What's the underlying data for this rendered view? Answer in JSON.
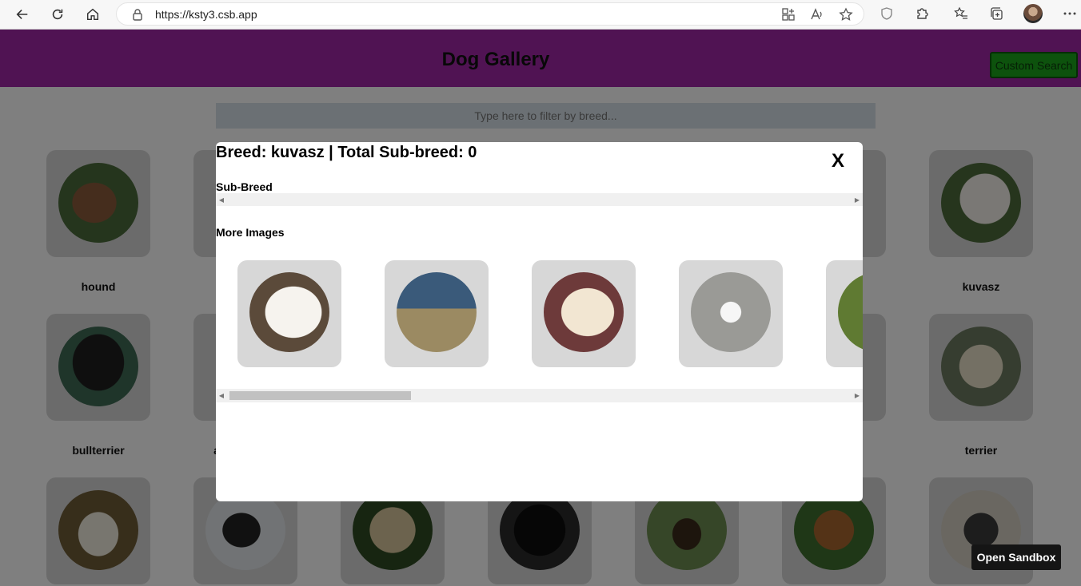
{
  "browser": {
    "url": "https://ksty3.csb.app"
  },
  "page": {
    "title": "Dog Gallery",
    "custom_search_label": "Custom Search",
    "filter_placeholder": "Type here to filter by breed..."
  },
  "gallery": {
    "labels": {
      "hound": "hound",
      "kuvasz": "kuvasz",
      "bullterrier": "bullterrier",
      "partial": "a",
      "terrier": "terrier"
    }
  },
  "modal": {
    "title": "Breed: kuvasz | Total Sub-breed: 0",
    "close": "X",
    "sub_breed_label": "Sub-Breed",
    "more_images_label": "More Images"
  },
  "sandbox": {
    "label": "Open Sandbox"
  },
  "colors": {
    "header": "#a126a6",
    "card": "#d7d7d7",
    "custom_button": "#1aa51a"
  }
}
